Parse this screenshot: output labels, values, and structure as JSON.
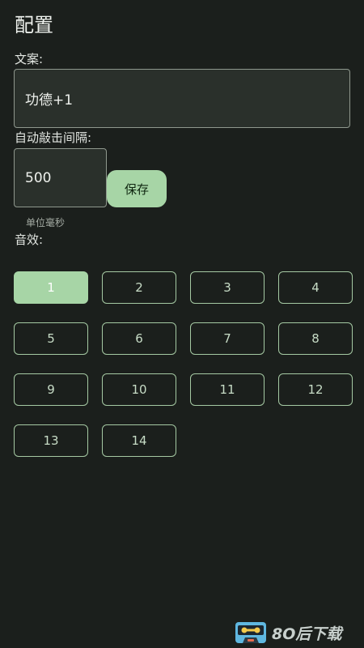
{
  "page": {
    "title": "配置"
  },
  "copy_section": {
    "label": "文案:",
    "value": "功德+1"
  },
  "interval_section": {
    "label": "自动敲击间隔:",
    "value": "500",
    "save_label": "保存",
    "helper": "单位毫秒"
  },
  "sound_section": {
    "label": "音效:",
    "selected": "1",
    "options": [
      "1",
      "2",
      "3",
      "4",
      "5",
      "6",
      "7",
      "8",
      "9",
      "10",
      "11",
      "12",
      "13",
      "14"
    ]
  },
  "watermark": {
    "text": "8O后下载",
    "icon": "cassette-icon"
  },
  "colors": {
    "background": "#1b1f1c",
    "accent": "#a7d5a6",
    "outline": "#a5c9a3"
  }
}
